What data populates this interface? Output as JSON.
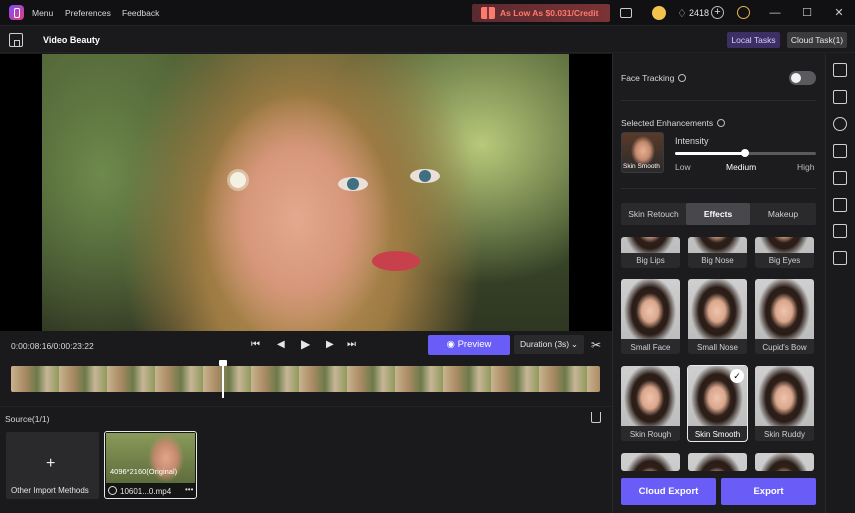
{
  "titlebar": {
    "menu": [
      "Menu",
      "Preferences",
      "Feedback"
    ],
    "promo": "As Low As $0.031/Credit",
    "credits": "2418",
    "window_controls": [
      "minimize-icon",
      "maximize-icon",
      "close-icon"
    ]
  },
  "header": {
    "title": "Video Beauty",
    "local_tasks": "Local Tasks",
    "cloud_task": "Cloud Task(1)"
  },
  "player": {
    "time": "0:00:08:16/0:00:23:22",
    "preview": "Preview",
    "duration": "Duration (3s)",
    "playhead_fraction": 0.36
  },
  "source": {
    "label": "Source(1/1)",
    "import_label": "Other Import Methods",
    "clip_resolution": "4096*2160(Original)",
    "clip_name": "10601...0.mp4"
  },
  "panel": {
    "face_tracking": "Face Tracking",
    "face_tracking_on": false,
    "selected_enhancements": "Selected Enhancements",
    "selected_item": "Skin Smooth",
    "intensity": "Intensity",
    "intensity_level": "Medium",
    "levels": [
      "Low",
      "Medium",
      "High"
    ],
    "tabs": [
      "Skin Retouch",
      "Effects",
      "Makeup"
    ],
    "active_tab": "Effects",
    "items_row0": [
      "Big Lips",
      "Big Nose",
      "Big Eyes"
    ],
    "items_row1": [
      "Small Face",
      "Small Nose",
      "Cupid's Bow"
    ],
    "items_row2": [
      "Skin Rough",
      "Skin Smooth",
      "Skin Ruddy"
    ],
    "selected_effect": "Skin Smooth",
    "cloud_export": "Cloud Export",
    "export": "Export"
  },
  "colors": {
    "accent": "#6a5cf6",
    "promo_text": "#ff7a6e",
    "background": "#1a1a1c"
  },
  "icons": [
    "app-logo-icon",
    "chat-icon",
    "coin-icon",
    "gem-icon",
    "add-credit-icon",
    "user-icon",
    "home-icon",
    "skip-start-icon",
    "prev-frame-icon",
    "play-icon",
    "next-frame-icon",
    "skip-end-icon",
    "eye-icon",
    "chevron-down-icon",
    "scissors-icon",
    "trash-icon",
    "plus-icon",
    "info-icon",
    "check-icon"
  ]
}
